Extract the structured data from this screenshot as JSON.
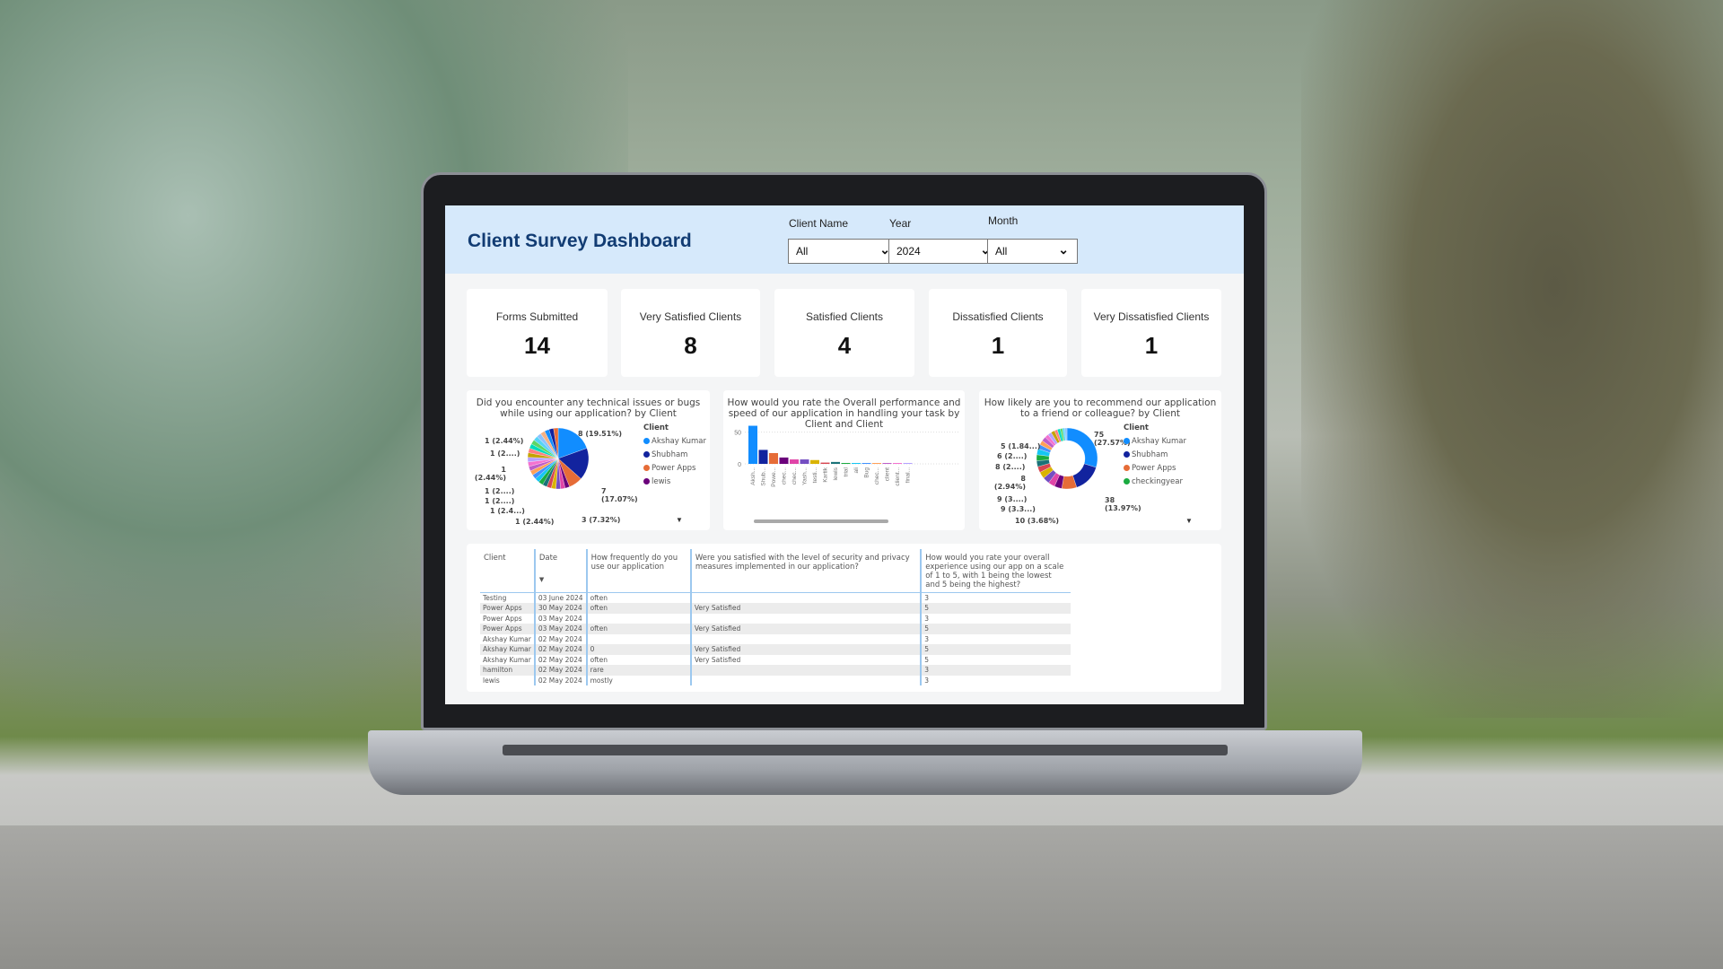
{
  "header": {
    "title": "Client Survey Dashboard"
  },
  "filters": [
    {
      "label": "Client Name",
      "value": "All"
    },
    {
      "label": "Year",
      "value": "2024"
    },
    {
      "label": "Month",
      "value": "All"
    }
  ],
  "kpis": [
    {
      "label": "Forms Submitted",
      "value": "14"
    },
    {
      "label": "Very Satisfied Clients",
      "value": "8"
    },
    {
      "label": "Satisfied Clients",
      "value": "4"
    },
    {
      "label": "Dissatisfied Clients",
      "value": "1"
    },
    {
      "label": "Very Dissatisfied Clients",
      "value": "1"
    }
  ],
  "palette": [
    "#118dff",
    "#12239e",
    "#e66c37",
    "#6b007b",
    "#e044a7",
    "#744ec2",
    "#d9b300",
    "#d64550",
    "#197278",
    "#1aab40",
    "#15c6f4",
    "#4092ff",
    "#ffa058",
    "#be5dc9",
    "#f472d0",
    "#b5a1ff",
    "#c4a200",
    "#ff8080",
    "#00dbbc",
    "#5bd667",
    "#55d4f6",
    "#8bc3ff",
    "#f4b183"
  ],
  "chart_data": [
    {
      "type": "pie",
      "title": "Did you encounter any technical issues or bugs while using our application? by Client",
      "legend_title": "Client",
      "legend": [
        "Akshay Kumar",
        "Shubham",
        "Power Apps",
        "lewis"
      ],
      "legend_placement": "right",
      "values": [
        8,
        7,
        3,
        1,
        1,
        1,
        1,
        1,
        1,
        1,
        1,
        1,
        1,
        1,
        1,
        1,
        1,
        1,
        1,
        1,
        1,
        1,
        1,
        1,
        1,
        1
      ],
      "data_labels": [
        "8 (19.51%)",
        "7 (17.07%)",
        "3 (7.32%)",
        "1 (2.44%)",
        "1 (2.4...)",
        "1 (2....)",
        "1 (2....)",
        "1 (2.44%)",
        "1 (2....)",
        "1 (2.44%)"
      ]
    },
    {
      "type": "bar",
      "title": "How would you rate the Overall performance and speed of our application in handling your task by Client and Client",
      "categories": [
        "Aksh...",
        "Shub...",
        "Powe...",
        "chec...",
        "chec...",
        "Yash...",
        "testi...",
        "Kartik",
        "lewis",
        "trial",
        "ali",
        "Bug",
        "chec...",
        "client",
        "client...",
        "final..."
      ],
      "values": [
        60,
        22,
        17,
        10,
        7,
        7,
        6,
        2,
        3,
        1,
        1,
        1,
        1,
        1,
        1,
        1
      ],
      "yticks": [
        0,
        50
      ],
      "ylim": [
        0,
        65
      ],
      "grid": true
    },
    {
      "type": "donut",
      "title": "How likely are you to recommend our application to a friend or colleague? by Client",
      "legend_title": "Client",
      "legend": [
        "Akshay Kumar",
        "Shubham",
        "Power Apps",
        "checkingyear"
      ],
      "legend_placement": "right",
      "values": [
        75,
        38,
        20,
        10,
        9,
        9,
        9,
        8,
        8,
        8,
        8,
        6,
        6,
        6,
        5,
        5,
        5,
        4,
        4,
        3,
        3,
        3
      ],
      "data_labels": [
        "75 (27.57%)",
        "38 (13.97%)",
        "10 (3.68%)",
        "9 (3.3...)",
        "9 (3....)",
        "8 (2.94%)",
        "8 (2....)",
        "6 (2....)",
        "5 (1.84...)"
      ]
    }
  ],
  "table": {
    "headers": [
      "Client",
      "Date",
      "How frequently do you use our application",
      "Were you satisfied with the level of security and privacy measures implemented in our application?",
      "How would you rate your overall experience using our app on a scale of 1 to 5, with 1 being the lowest and 5 being the highest?"
    ],
    "rows": [
      [
        "Testing",
        "03 June 2024",
        "often",
        "",
        "3"
      ],
      [
        "Power Apps",
        "30 May 2024",
        "often",
        "Very Satisfied",
        "5"
      ],
      [
        "Power Apps",
        "03 May 2024",
        "",
        "",
        "3"
      ],
      [
        "Power Apps",
        "03 May 2024",
        "often",
        "Very Satisfied",
        "5"
      ],
      [
        "Akshay Kumar",
        "02 May 2024",
        "",
        "",
        "3"
      ],
      [
        "Akshay Kumar",
        "02 May 2024",
        "0",
        "Very Satisfied",
        "5"
      ],
      [
        "Akshay Kumar",
        "02 May 2024",
        "often",
        "Very Satisfied",
        "5"
      ],
      [
        "hamilton",
        "02 May 2024",
        "rare",
        "",
        "3"
      ],
      [
        "lewis",
        "02 May 2024",
        "mostly",
        "",
        "3"
      ]
    ]
  }
}
